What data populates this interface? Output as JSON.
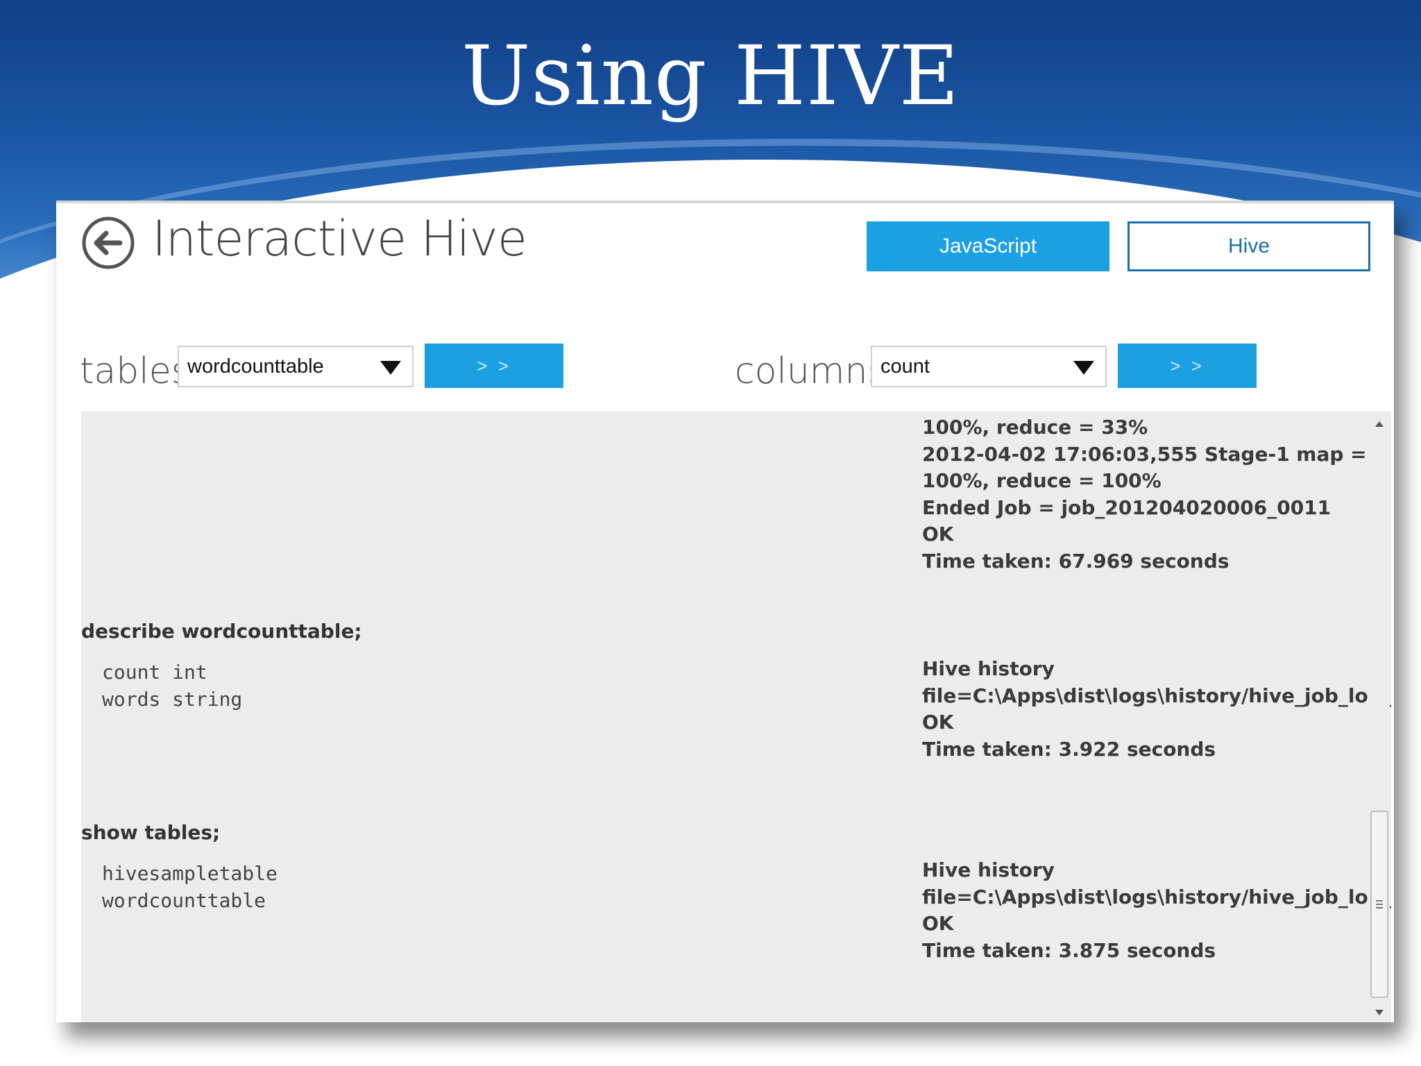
{
  "slide": {
    "title": "Using HIVE"
  },
  "app": {
    "title": "Interactive Hive",
    "back_icon": "back-arrow-circle-icon",
    "mode_buttons": {
      "javascript": "JavaScript",
      "hive": "Hive"
    },
    "tables": {
      "label": "tables",
      "selected": "wordcounttable",
      "go_label": "> >"
    },
    "columns": {
      "label": "columns",
      "selected": "count",
      "go_label": "> >"
    }
  },
  "console": {
    "job_output": [
      "100%, reduce = 33%",
      "2012-04-02 17:06:03,555 Stage-1 map =",
      "100%, reduce = 100%",
      "Ended Job = job_201204020006_0011",
      "OK",
      "Time taken: 67.969 seconds"
    ],
    "blocks": [
      {
        "command": "describe wordcounttable;",
        "result": [
          "count int",
          "words string"
        ],
        "log": [
          "Hive history",
          "file=C:\\Apps\\dist\\logs\\history/hive_job_log_l",
          "OK",
          "Time taken: 3.922 seconds"
        ]
      },
      {
        "command": "show tables;",
        "result": [
          "hivesampletable",
          "wordcounttable"
        ],
        "log": [
          "Hive history",
          "file=C:\\Apps\\dist\\logs\\history/hive_job_log_l",
          "OK",
          "Time taken: 3.875 seconds"
        ]
      }
    ]
  },
  "colors": {
    "accent": "#1ba1e2",
    "hive_border": "#1a6fb0",
    "console_bg": "#ececec"
  }
}
